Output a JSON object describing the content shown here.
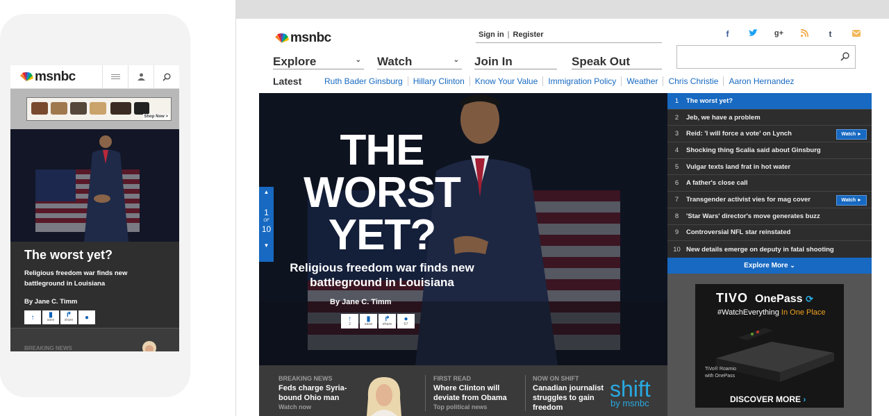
{
  "colors": {
    "accent": "#1769c1",
    "dark": "#2d2d2d",
    "strip": "#3a3a3a"
  },
  "mobile": {
    "logo": "msnbc",
    "icons": [
      "menu-icon",
      "user-icon",
      "search-icon"
    ],
    "ad_label": "Shop Now >",
    "headline": "The worst yet?",
    "subhead": "Religious freedom war finds new battleground in Louisiana",
    "byline": "By Jane C. Timm",
    "actions": [
      {
        "icon": "upvote-icon",
        "label": ""
      },
      {
        "icon": "bookmark-icon",
        "label": "save"
      },
      {
        "icon": "share-icon",
        "label": "share"
      },
      {
        "icon": "comment-icon",
        "label": ""
      }
    ],
    "breaking_label": "BREAKING NEWS"
  },
  "desktop": {
    "logo": "msnbc",
    "sign_in": "Sign in",
    "divider": "|",
    "register": "Register",
    "social": [
      {
        "icon": "facebook-icon",
        "glyph": "f",
        "color": "#3b5998"
      },
      {
        "icon": "twitter-icon",
        "glyph": "t",
        "color": "#1da1f2"
      },
      {
        "icon": "googleplus-icon",
        "glyph": "g+",
        "color": "#444"
      },
      {
        "icon": "rss-icon",
        "glyph": "))",
        "color": "#f2a33a"
      },
      {
        "icon": "tumblr-icon",
        "glyph": "t",
        "color": "#35465c"
      },
      {
        "icon": "email-icon",
        "glyph": "✉",
        "color": "#f2a33a"
      }
    ],
    "search_placeholder": "",
    "nav": [
      "Explore",
      "Watch",
      "Join In",
      "Speak Out"
    ],
    "latest_label": "Latest",
    "latest_links": [
      "Ruth Bader Ginsburg",
      "Hillary Clinton",
      "Know Your Value",
      "Immigration Policy",
      "Weather",
      "Chris Christie",
      "Aaron Hernandez"
    ],
    "hero": {
      "line1": "THE",
      "line2": "WORST",
      "line3": "YET?",
      "subhead": "Religious freedom war finds new battleground in Louisiana",
      "byline": "By Jane C. Timm",
      "actions": [
        {
          "icon": "upvote-icon",
          "label": "2"
        },
        {
          "icon": "bookmark-icon",
          "label": "save"
        },
        {
          "icon": "share-icon",
          "label": "share"
        },
        {
          "icon": "comment-icon",
          "label": "67"
        }
      ],
      "pager_current": "1",
      "pager_of": "OF",
      "pager_total": "10"
    },
    "trending": [
      {
        "n": "1",
        "title": "The worst yet?",
        "watch": false
      },
      {
        "n": "2",
        "title": "Jeb, we have a problem",
        "watch": false
      },
      {
        "n": "3",
        "title": "Reid: 'I will force a vote' on Lynch",
        "watch": true
      },
      {
        "n": "4",
        "title": "Shocking thing Scalia said about Ginsburg",
        "watch": false
      },
      {
        "n": "5",
        "title": "Vulgar texts land frat in hot water",
        "watch": false
      },
      {
        "n": "6",
        "title": "A father's close call",
        "watch": false
      },
      {
        "n": "7",
        "title": "Transgender activist vies for mag cover",
        "watch": true
      },
      {
        "n": "8",
        "title": "'Star Wars' director's move generates buzz",
        "watch": false
      },
      {
        "n": "9",
        "title": "Controversial NFL star reinstated",
        "watch": false
      },
      {
        "n": "10",
        "title": "New details emerge on deputy in fatal shooting",
        "watch": false
      }
    ],
    "watch_label": "Watch ►",
    "explore_more": "Explore More",
    "ad": {
      "brand": "TIVO",
      "product": "OnePass",
      "hashtag": "#WatchEverything",
      "tag_suffix": "In One Place",
      "device_line1": "TiVo® Roamio",
      "device_line2": "with OnePass",
      "cta": "DISCOVER MORE"
    },
    "strip": [
      {
        "kicker": "BREAKING NEWS",
        "headline": "Feds charge Syria-bound Ohio man",
        "sub": "Watch now"
      },
      {
        "kicker": "FIRST READ",
        "headline": "Where Clinton will deviate from Obama",
        "sub": "Top political news"
      },
      {
        "kicker": "NOW ON SHIFT",
        "headline": "Canadian journalist struggles to gain freedom",
        "sub": ""
      }
    ],
    "shift_logo": "shift",
    "shift_by": "by msnbc"
  }
}
